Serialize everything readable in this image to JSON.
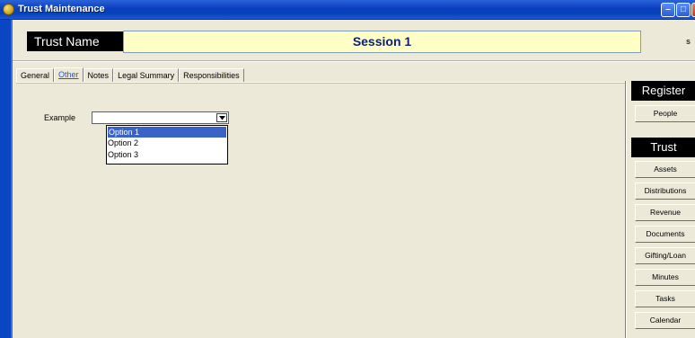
{
  "window": {
    "title": "Trust Maintenance",
    "controls": {
      "minimize": "–",
      "maximize": "□",
      "close": "x"
    }
  },
  "header": {
    "trust_name_label": "Trust Name",
    "session_value": "Session 1",
    "right_mark": "s"
  },
  "tabs": [
    {
      "label": "General",
      "active": false
    },
    {
      "label": "Other",
      "active": true
    },
    {
      "label": "Notes",
      "active": false
    },
    {
      "label": "Legal Summary",
      "active": false
    },
    {
      "label": "Responsibilities",
      "active": false
    }
  ],
  "form": {
    "example_label": "Example",
    "example_value": "",
    "options": [
      "Option 1",
      "Option 2",
      "Option 3"
    ],
    "highlighted_option": "Option 1"
  },
  "side_panel": {
    "register_header": "Register",
    "register_buttons": [
      "People"
    ],
    "trust_header": "Trust",
    "trust_buttons": [
      "Assets",
      "Distributions",
      "Revenue",
      "Documents",
      "Gifting/Loan",
      "Minutes",
      "Tasks",
      "Calendar"
    ]
  },
  "colors": {
    "titlebar": "#0a3fbf",
    "session_field_bg": "#ffffc6",
    "session_text": "#0a1e7a",
    "dialog_bg": "#ece9d8",
    "selection": "#3a63c8"
  }
}
